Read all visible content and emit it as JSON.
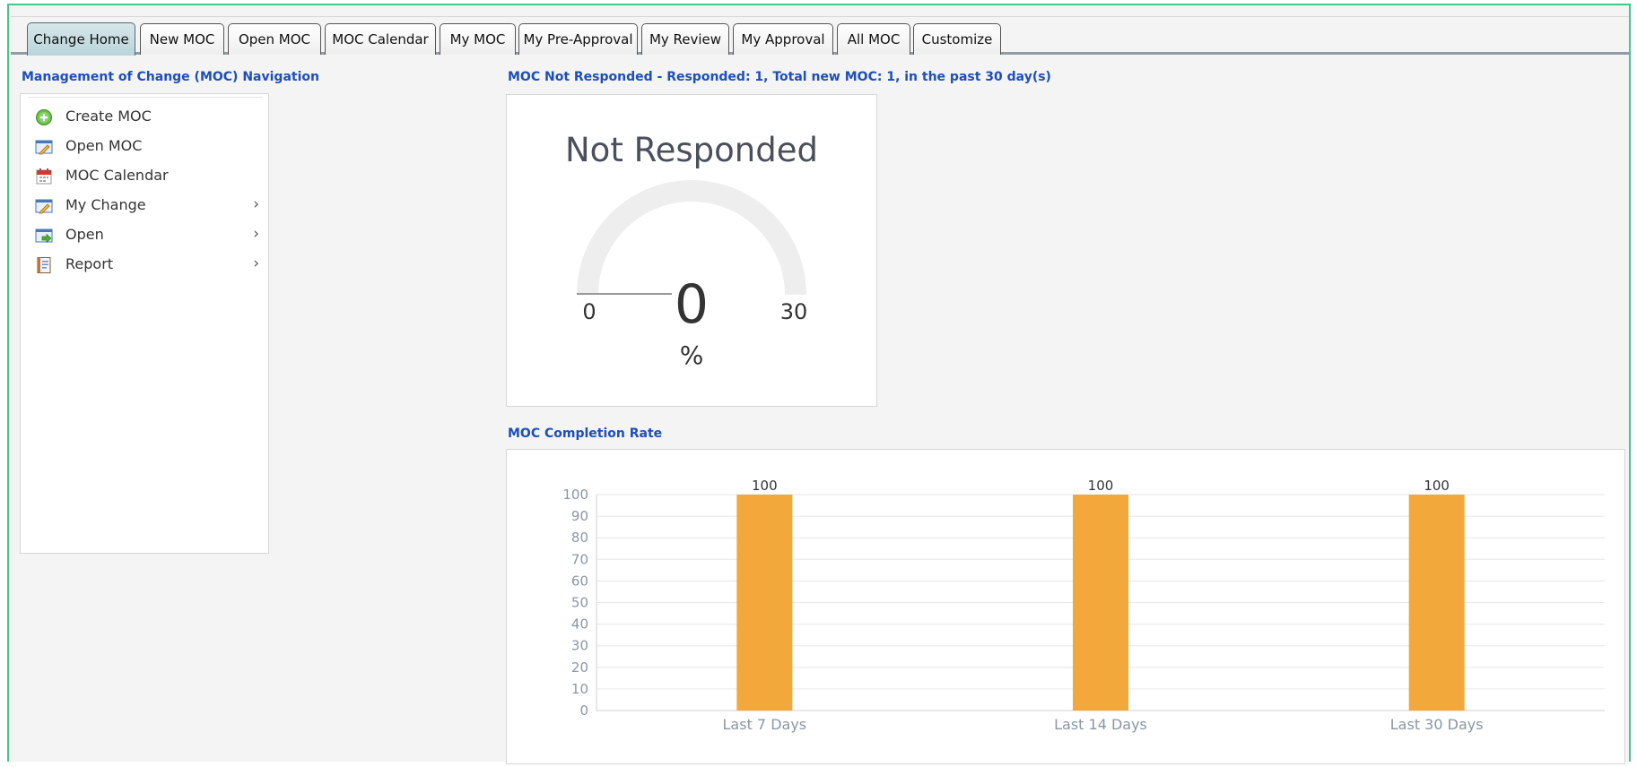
{
  "tabs": [
    {
      "label": "Change Home",
      "active": true
    },
    {
      "label": "New MOC"
    },
    {
      "label": "Open MOC"
    },
    {
      "label": "MOC Calendar"
    },
    {
      "label": "My MOC"
    },
    {
      "label": "My Pre-Approval"
    },
    {
      "label": "My Review"
    },
    {
      "label": "My Approval"
    },
    {
      "label": "All MOC"
    },
    {
      "label": "Customize"
    }
  ],
  "navigation": {
    "title": "Management of Change (MOC) Navigation",
    "items": [
      {
        "label": "Create MOC",
        "icon": "add-circle-icon",
        "submenu": false
      },
      {
        "label": "Open MOC",
        "icon": "edit-window-icon",
        "submenu": false
      },
      {
        "label": "MOC Calendar",
        "icon": "calendar-icon",
        "submenu": false
      },
      {
        "label": "My Change",
        "icon": "edit-window-icon",
        "submenu": true
      },
      {
        "label": "Open",
        "icon": "open-window-icon",
        "submenu": true
      },
      {
        "label": "Report",
        "icon": "report-book-icon",
        "submenu": true
      }
    ],
    "chevron": "›"
  },
  "gauge": {
    "section_title": "MOC Not Responded - Responded: 1, Total new MOC: 1, in the past 30 day(s)",
    "title": "Not Responded",
    "value": "0",
    "min": "0",
    "max": "30",
    "unit": "%"
  },
  "completion": {
    "section_title": "MOC Completion Rate"
  },
  "chart_data": {
    "type": "bar",
    "categories": [
      "Last 7 Days",
      "Last 14 Days",
      "Last 30 Days"
    ],
    "values": [
      100,
      100,
      100
    ],
    "data_labels": [
      "100",
      "100",
      "100"
    ],
    "ylim": [
      0,
      100
    ],
    "yticks": [
      0,
      10,
      20,
      30,
      40,
      50,
      60,
      70,
      80,
      90,
      100
    ],
    "grid": true,
    "bar_color": "#f2a83b"
  },
  "colors": {
    "accent_blue": "#1d4fb8",
    "frame_green": "#3fc98a",
    "gauge_track": "#eeeeee",
    "gauge_needle": "#999999"
  }
}
